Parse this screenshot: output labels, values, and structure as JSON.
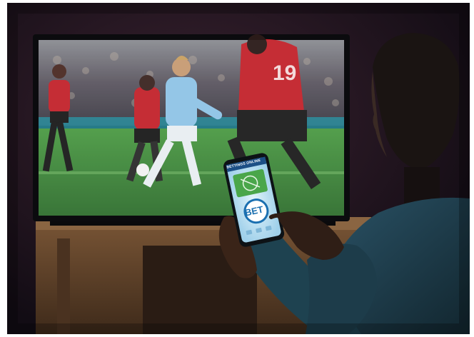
{
  "tv": {
    "player_number": "19"
  },
  "phone": {
    "app_brand": "BETTINGS ONLINE",
    "bet_button_label": "BET"
  },
  "colors": {
    "room_dark": "#161018",
    "pitch_green": "#3f8a3c",
    "red_kit": "#c2222b",
    "sky_kit": "#8fc3e6",
    "phone_screen": "#d4ecf7",
    "phone_green": "#4aa64a",
    "bet_blue": "#1a6fb0",
    "shirt_blue": "#1d3a4a",
    "wood": "#6b4a30"
  }
}
